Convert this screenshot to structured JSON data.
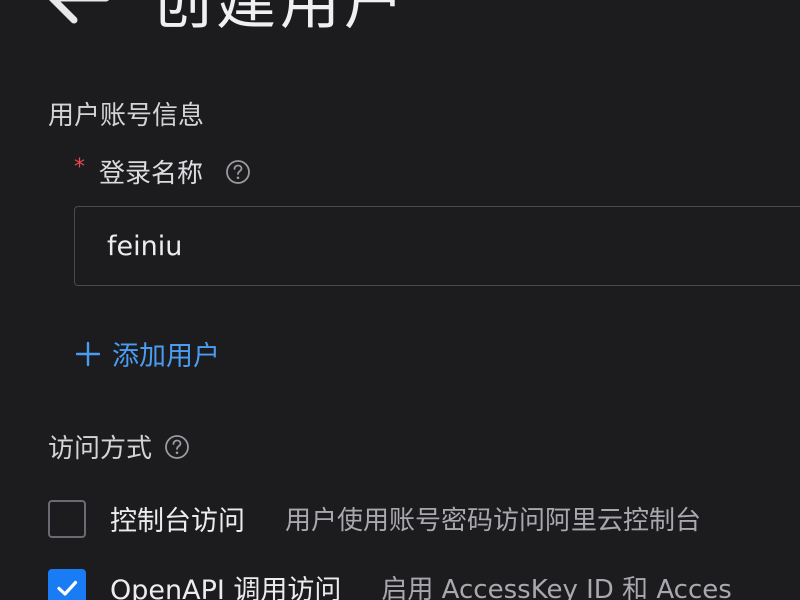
{
  "header": {
    "back_icon": "arrow-left-icon",
    "title": "创建用户"
  },
  "account_section": {
    "title": "用户账号信息",
    "login_name": {
      "required_mark": "*",
      "label": "登录名称",
      "help_icon": "question-circle-icon",
      "value": "feiniu"
    },
    "add_user": {
      "icon": "plus-icon",
      "label": "添加用户"
    }
  },
  "access_section": {
    "title": "访问方式",
    "help_icon": "question-circle-icon",
    "options": [
      {
        "label": "控制台访问",
        "description": "用户使用账号密码访问阿里云控制台",
        "checked": false
      },
      {
        "label": "OpenAPI 调用访问",
        "description": "启用 AccessKey ID 和 Acces",
        "checked": true
      }
    ]
  },
  "colors": {
    "background": "#1c1c1e",
    "accent_link": "#4a9cf0",
    "checkbox_checked": "#1a7cf5",
    "required": "#e5484d"
  }
}
